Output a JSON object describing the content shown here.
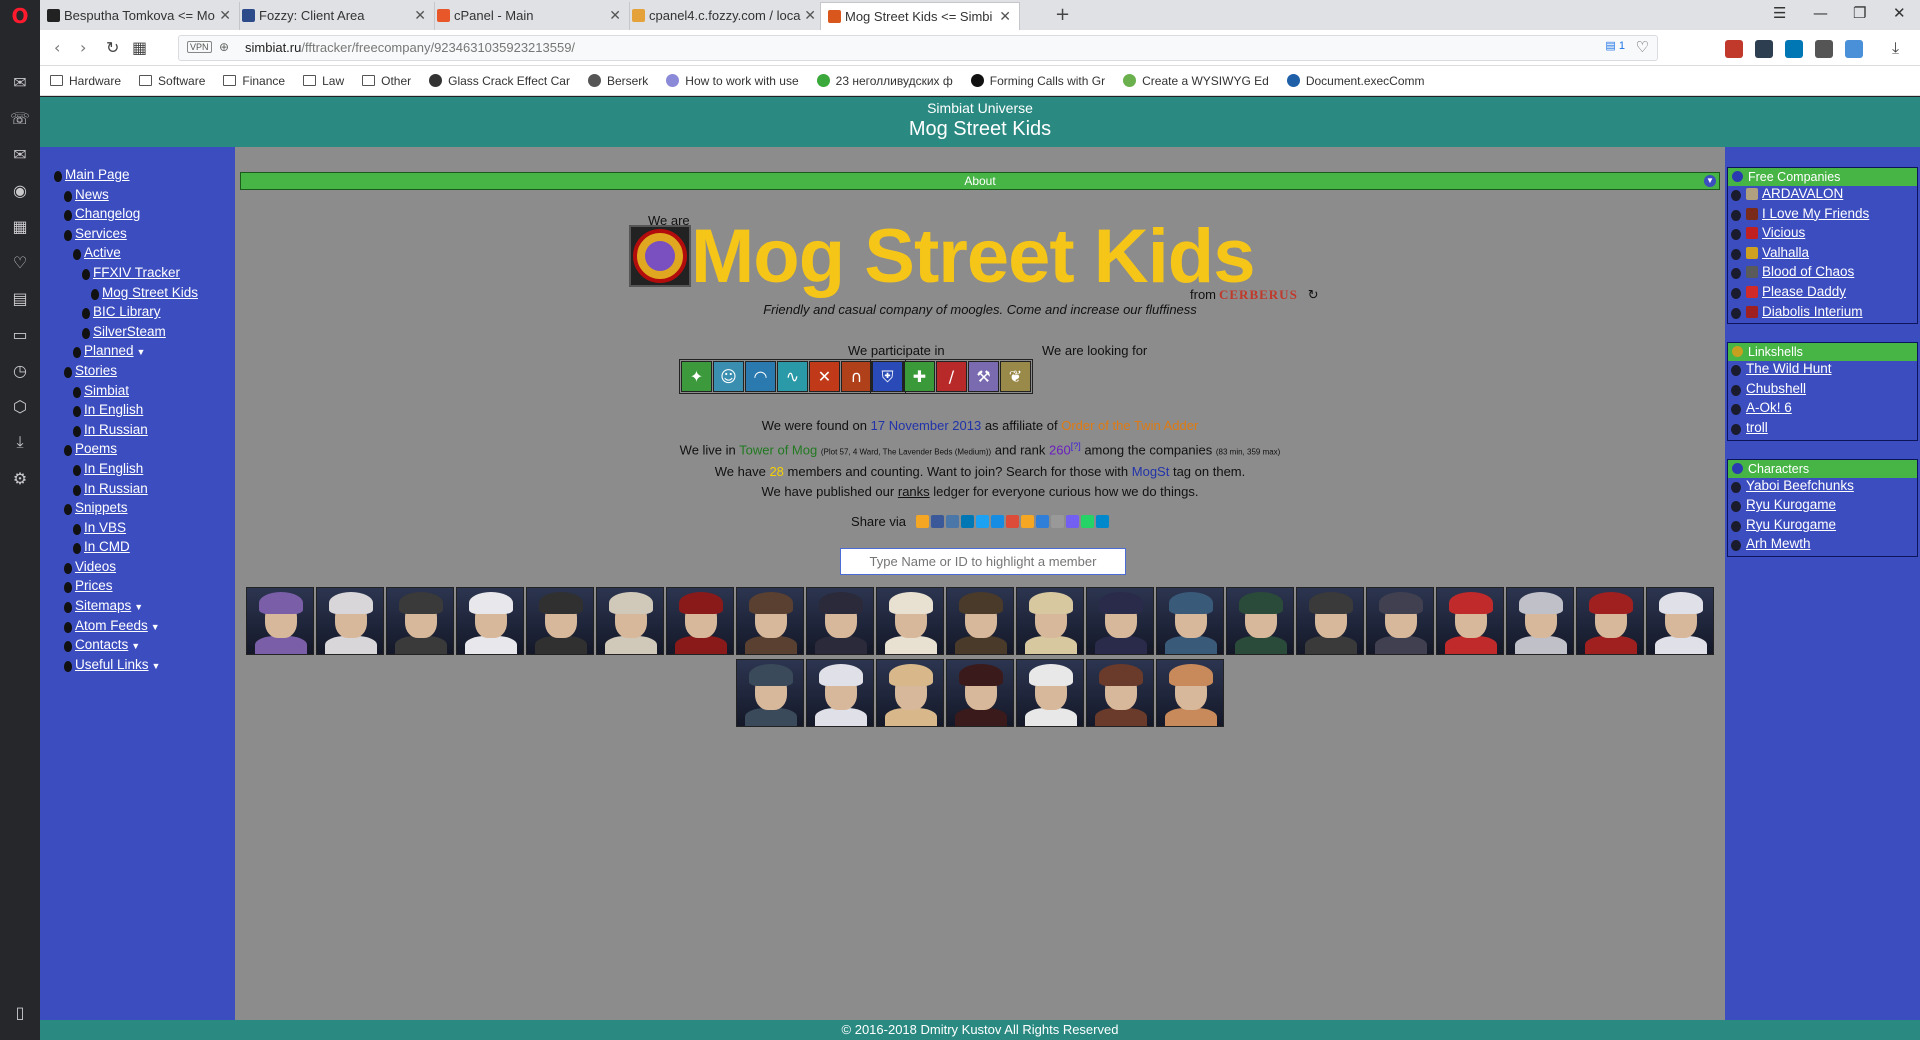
{
  "browser": {
    "tabs": [
      {
        "title": "Besputha Tomkova <= Mo",
        "fav": "#222222"
      },
      {
        "title": "Fozzy: Client Area",
        "fav": "#2d4a8a"
      },
      {
        "title": "cPanel - Main",
        "fav": "#e8572a"
      },
      {
        "title": "cpanel4.c.fozzy.com / loca",
        "fav": "#e5a23a"
      },
      {
        "title": "Mog Street Kids <= Simbi",
        "fav": "#d9561c"
      }
    ],
    "url_host": "simbiat.ru",
    "url_path": "/fftracker/freecompany/9234631035923213559/",
    "vpn_label": "VPN",
    "zoom_badge": "1",
    "bookmarks": [
      {
        "label": "Hardware",
        "type": "folder"
      },
      {
        "label": "Software",
        "type": "folder"
      },
      {
        "label": "Finance",
        "type": "folder"
      },
      {
        "label": "Law",
        "type": "folder"
      },
      {
        "label": "Other",
        "type": "folder"
      },
      {
        "label": "Glass Crack Effect Car",
        "type": "site",
        "color": "#333333"
      },
      {
        "label": "Berserk",
        "type": "site",
        "color": "#555555"
      },
      {
        "label": "How to work with use",
        "type": "site",
        "color": "#8a8ad8"
      },
      {
        "label": "23 неголливудских ф",
        "type": "site",
        "color": "#3aa83a"
      },
      {
        "label": "Forming Calls with Gr",
        "type": "site",
        "color": "#111111"
      },
      {
        "label": "Create a WYSIWYG Ed",
        "type": "site",
        "color": "#6ab04c"
      },
      {
        "label": "Document.execComm",
        "type": "site",
        "color": "#1e5fa8"
      }
    ]
  },
  "header": {
    "universe": "Simbiat Universe",
    "title": "Mog Street Kids"
  },
  "leftnav": [
    {
      "label": "Main Page",
      "indent": 0
    },
    {
      "label": "News",
      "indent": 1
    },
    {
      "label": "Changelog",
      "indent": 1
    },
    {
      "label": "Services",
      "indent": 1
    },
    {
      "label": "Active",
      "indent": 2
    },
    {
      "label": "FFXIV Tracker",
      "indent": 3
    },
    {
      "label": "Mog Street Kids",
      "indent": 4
    },
    {
      "label": "BIC Library",
      "indent": 3
    },
    {
      "label": "SilverSteam",
      "indent": 3
    },
    {
      "label": "Planned",
      "indent": 2,
      "caret": true
    },
    {
      "label": "Stories",
      "indent": 1
    },
    {
      "label": "Simbiat",
      "indent": 2
    },
    {
      "label": "In English",
      "indent": 2
    },
    {
      "label": "In Russian",
      "indent": 2
    },
    {
      "label": "Poems",
      "indent": 1
    },
    {
      "label": "In English",
      "indent": 2
    },
    {
      "label": "In Russian",
      "indent": 2
    },
    {
      "label": "Snippets",
      "indent": 1
    },
    {
      "label": "In VBS",
      "indent": 2
    },
    {
      "label": "In CMD",
      "indent": 2
    },
    {
      "label": "Videos",
      "indent": 1
    },
    {
      "label": "Prices",
      "indent": 1
    },
    {
      "label": "Sitemaps",
      "indent": 1,
      "caret": true
    },
    {
      "label": "Atom Feeds",
      "indent": 1,
      "caret": true
    },
    {
      "label": "Contacts",
      "indent": 1,
      "caret": true
    },
    {
      "label": "Useful Links",
      "indent": 1,
      "caret": true
    }
  ],
  "about": {
    "bar_label": "About",
    "we_are": "We are",
    "name": "Mog Street Kids",
    "from": "from",
    "server": "CERBERUS",
    "slogan": "Friendly and casual company of moogles. Come and increase our fluffiness",
    "participate_label": "We participate in",
    "looking_label": "We are looking for",
    "found_prefix": "We were found on",
    "found_date": "17 November 2013",
    "found_mid": "as affiliate of",
    "affiliate": "Order of the Twin Adder",
    "live_prefix": "We live in",
    "estate": "Tower of Mog",
    "estate_detail": "(Plot 57, 4 Ward, The Lavender Beds (Medium))",
    "rank_prefix": "and rank",
    "rank": "260",
    "rank_sup": "[?]",
    "rank_suffix": "among the companies",
    "rank_detail": "(83 min, 359 max)",
    "members_prefix": "We have",
    "members_count": "28",
    "members_mid": "members and counting. Want to join? Search for those with",
    "tag": "MogSt",
    "members_suffix": "tag on them.",
    "ranks_prefix": "We have published our",
    "ranks_link": "ranks",
    "ranks_suffix": "ledger for everyone curious how we do things.",
    "share_label": "Share via",
    "search_placeholder": "Type Name or ID to highlight a member"
  },
  "participate_icons": [
    {
      "name": "role-playing-icon",
      "color": "#3c9a3c",
      "glyph": "✦"
    },
    {
      "name": "leveling-icon",
      "color": "#3a8fb0",
      "glyph": "☺"
    },
    {
      "name": "casual-icon",
      "color": "#2a7ab0",
      "glyph": "◠"
    },
    {
      "name": "hardcore-icon",
      "color": "#2a9aa8",
      "glyph": "∿"
    },
    {
      "name": "dungeons-icon",
      "color": "#c03a1a",
      "glyph": "✕"
    },
    {
      "name": "guildhests-icon",
      "color": "#b0401a",
      "glyph": "∩"
    },
    {
      "name": "pvp-icon",
      "color": "#c8401c",
      "glyph": "⚔"
    }
  ],
  "looking_icons": [
    {
      "name": "tank-icon",
      "color": "#2a4ab8",
      "glyph": "⛨"
    },
    {
      "name": "healer-icon",
      "color": "#3a9a3a",
      "glyph": "✚"
    },
    {
      "name": "dps-icon",
      "color": "#b82a2a",
      "glyph": "/"
    },
    {
      "name": "crafter-icon",
      "color": "#7a6ab0",
      "glyph": "⚒"
    },
    {
      "name": "gatherer-icon",
      "color": "#9a8a4a",
      "glyph": "❦"
    }
  ],
  "share_colors": [
    "#f5a623",
    "#3b5998",
    "#4a76a8",
    "#0077b5",
    "#1da1f2",
    "#168de2",
    "#dd4b39",
    "#f5a623",
    "#2f7ed8",
    "#999999",
    "#7360f2",
    "#25d366",
    "#0088cc"
  ],
  "members_row1": [
    "#7a5fa8",
    "#d8d6d8",
    "#3a3a3a",
    "#e8e8ec",
    "#303030",
    "#d0c8b8",
    "#8a1a1a",
    "#5a4030",
    "#2a2a3a",
    "#e8e0d0",
    "#4a3a2a",
    "#d8c8a0",
    "#2a2a4a",
    "#3a5a7a",
    "#2a4a3a",
    "#3a3a3a",
    "#404050",
    "#c02a2a",
    "#c0c0c8",
    "#a02020",
    "#e0e0e8"
  ],
  "members_row2": [
    "#3a4a5a",
    "#e0e0e8",
    "#d8b88a",
    "#3a1a1a",
    "#e8e8e8",
    "#6a3a2a",
    "#c88a5a"
  ],
  "free_companies": {
    "title": "Free Companies",
    "items": [
      {
        "label": "ARDAVALON",
        "crest": "#b0a080"
      },
      {
        "label": "I Love My Friends",
        "crest": "#7a2a1a"
      },
      {
        "label": "Vicious",
        "crest": "#c02020"
      },
      {
        "label": "Valhalla",
        "crest": "#d0a020"
      },
      {
        "label": "Blood of Chaos",
        "crest": "#5a5a5a"
      },
      {
        "label": "Please Daddy",
        "crest": "#d02a2a"
      },
      {
        "label": "Diabolis Interium",
        "crest": "#a02020"
      }
    ]
  },
  "linkshells": {
    "title": "Linkshells",
    "items": [
      "The Wild Hunt",
      "Chubshell",
      "A-Ok! 6",
      "troll"
    ]
  },
  "characters": {
    "title": "Characters",
    "items": [
      "Yaboi Beefchunks",
      "Ryu Kurogame",
      "Ryu Kurogame",
      "Arh Mewth"
    ]
  },
  "footer": "© 2016-2018 Dmitry Kustov All Rights Reserved",
  "colors": {
    "header": "#2a8a82",
    "sidebar": "#3c4dbf",
    "content_bg": "#8c8c8c",
    "accent_green": "#47b545",
    "fc_name": "#f5c518"
  }
}
